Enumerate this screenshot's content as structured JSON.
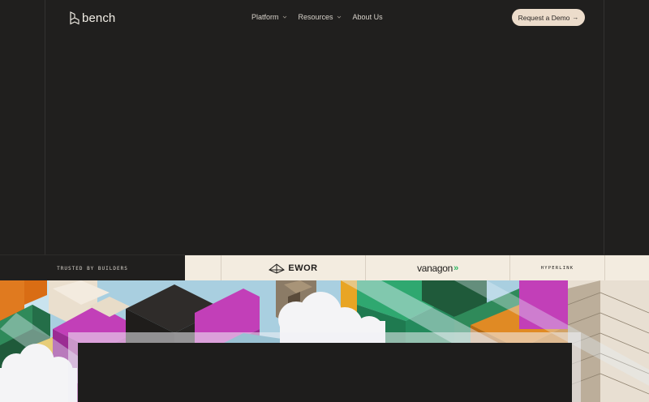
{
  "nav": {
    "logo_text": "bench",
    "links": [
      {
        "label": "Platform",
        "has_dropdown": true
      },
      {
        "label": "Resources",
        "has_dropdown": true
      },
      {
        "label": "About Us",
        "has_dropdown": false
      }
    ],
    "cta_label": "Request a Demo",
    "cta_icon": "arrow-right-icon"
  },
  "trust": {
    "label": "TRUSTED BY BUILDERS",
    "logos": [
      "EWOR",
      "vanagon",
      "HYPERLINK"
    ]
  },
  "colors": {
    "background": "#201f1e",
    "cta_background": "#ecdccb",
    "logo_strip": "#f3ece0",
    "vanagon_accent": "#2db863"
  }
}
